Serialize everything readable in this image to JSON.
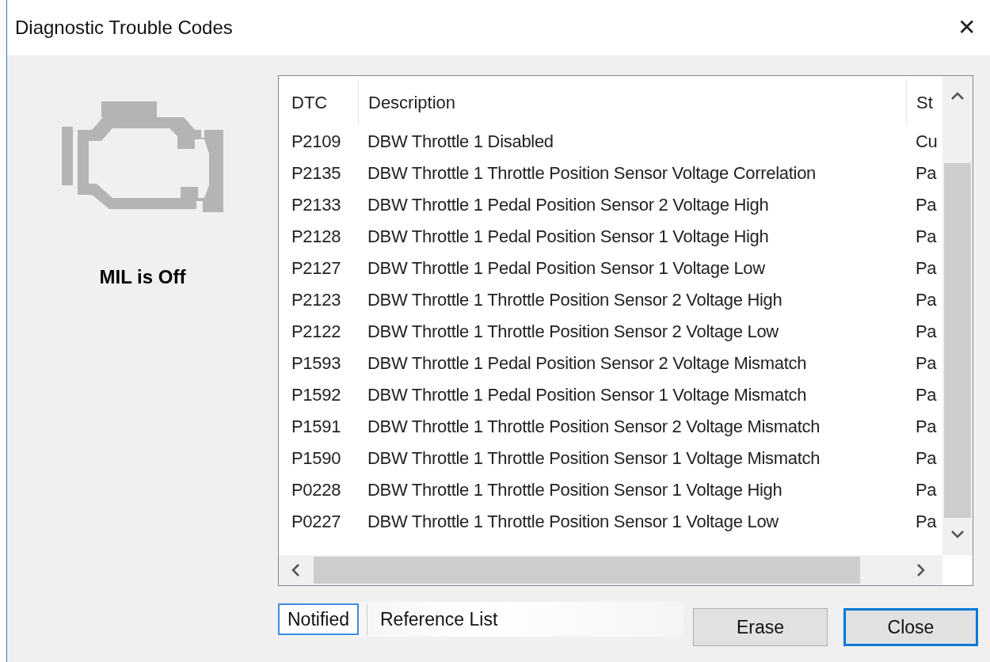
{
  "window": {
    "title": "Diagnostic Trouble Codes",
    "close": "✕"
  },
  "mil": {
    "on": false,
    "label": "MIL is Off"
  },
  "table": {
    "columns": [
      "DTC",
      "Description",
      "St"
    ],
    "rows": [
      {
        "dtc": "P2109",
        "description": "DBW Throttle 1 Disabled",
        "status": "Cu"
      },
      {
        "dtc": "P2135",
        "description": "DBW Throttle 1 Throttle Position Sensor Voltage Correlation",
        "status": "Pa"
      },
      {
        "dtc": "P2133",
        "description": "DBW Throttle 1 Pedal Position Sensor 2 Voltage High",
        "status": "Pa"
      },
      {
        "dtc": "P2128",
        "description": "DBW Throttle 1 Pedal Position Sensor 1 Voltage High",
        "status": "Pa"
      },
      {
        "dtc": "P2127",
        "description": "DBW Throttle 1 Pedal Position Sensor 1 Voltage Low",
        "status": "Pa"
      },
      {
        "dtc": "P2123",
        "description": "DBW Throttle 1 Throttle Position Sensor 2 Voltage High",
        "status": "Pa"
      },
      {
        "dtc": "P2122",
        "description": "DBW Throttle 1 Throttle Position Sensor 2 Voltage Low",
        "status": "Pa"
      },
      {
        "dtc": "P1593",
        "description": "DBW Throttle 1 Pedal Position Sensor 2 Voltage Mismatch",
        "status": "Pa"
      },
      {
        "dtc": "P1592",
        "description": "DBW Throttle 1 Pedal Position Sensor 1 Voltage Mismatch",
        "status": "Pa"
      },
      {
        "dtc": "P1591",
        "description": "DBW Throttle 1 Throttle Position Sensor 2 Voltage Mismatch",
        "status": "Pa"
      },
      {
        "dtc": "P1590",
        "description": "DBW Throttle 1 Throttle Position Sensor 1 Voltage Mismatch",
        "status": "Pa"
      },
      {
        "dtc": "P0228",
        "description": "DBW Throttle 1 Throttle Position Sensor 1 Voltage High",
        "status": "Pa"
      },
      {
        "dtc": "P0227",
        "description": "DBW Throttle 1 Throttle Position Sensor 1 Voltage Low",
        "status": "Pa"
      }
    ]
  },
  "tabs": [
    {
      "label": "Notified",
      "selected": true
    },
    {
      "label": "Reference List",
      "selected": false
    }
  ],
  "buttons": [
    {
      "label": "Erase",
      "default": false
    },
    {
      "label": "Close",
      "default": true
    }
  ]
}
